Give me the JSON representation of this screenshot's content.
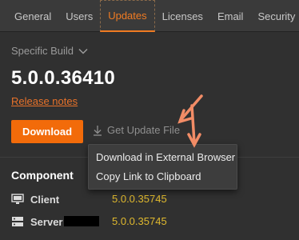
{
  "tabs": [
    {
      "label": "General"
    },
    {
      "label": "Users"
    },
    {
      "label": "Updates",
      "active": true
    },
    {
      "label": "Licenses"
    },
    {
      "label": "Email"
    },
    {
      "label": "Security"
    }
  ],
  "build_select": {
    "label": "Specific Build",
    "icon": "chevron-down-icon"
  },
  "version": "5.0.0.36410",
  "release_notes": "Release notes",
  "download_button": "Download",
  "get_update_file": {
    "label": "Get Update File",
    "icon": "download-icon"
  },
  "context_menu": {
    "items": [
      {
        "label": "Download in External Browser"
      },
      {
        "label": "Copy Link to Clipboard"
      }
    ]
  },
  "components": {
    "header": "Component",
    "rows": [
      {
        "name": "Client",
        "version": "5.0.0.35745",
        "icon": "monitor-icon"
      },
      {
        "name": "Server",
        "version": "5.0.0.35745",
        "icon": "server-icon"
      }
    ]
  },
  "colors": {
    "accent": "#f26b0a",
    "version_text": "#e0b92e",
    "annotation_arrow": "#f28c66",
    "background": "#303030"
  }
}
